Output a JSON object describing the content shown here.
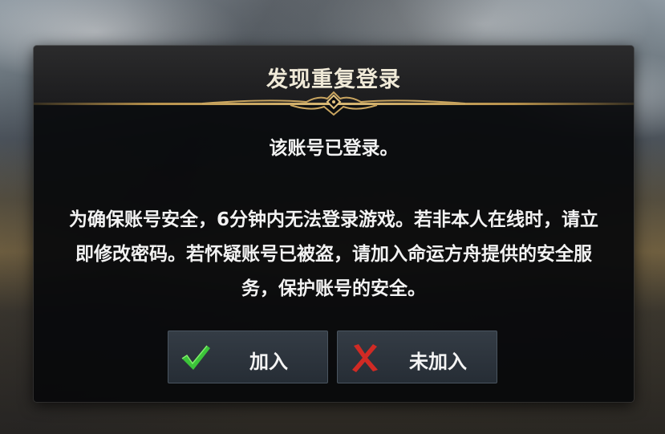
{
  "dialog": {
    "title": "发现重复登录",
    "message_line1": "该账号已登录。",
    "message_line2": "为确保账号安全，6分钟内无法登录游戏。若非本人在线时，请立即修改密码。若怀疑账号已被盗，请加入命运方舟提供的安全服务，保护账号的安全。"
  },
  "buttons": {
    "join": {
      "label": "加入",
      "icon": "checkmark-icon",
      "icon_color": "#3cc43a"
    },
    "not_join": {
      "label": "未加入",
      "icon": "x-mark-icon",
      "icon_color": "#d02a24"
    }
  },
  "colors": {
    "accent_gold": "#d7b773",
    "dialog_bg": "#08090b",
    "button_bg": "#2d343c"
  }
}
